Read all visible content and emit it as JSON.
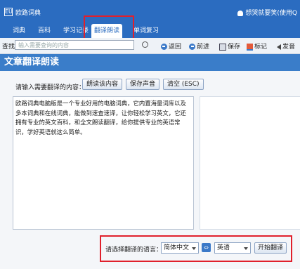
{
  "app": {
    "title": "欧路词典",
    "logo_text": "EU",
    "user": "想哭就要笑(使用Q"
  },
  "tabs": [
    {
      "label": "词典"
    },
    {
      "label": "百科"
    },
    {
      "label": "学习记录"
    },
    {
      "label": "翻译朗读",
      "active": true
    },
    {
      "label": "单词复习"
    }
  ],
  "toolbar": {
    "search_label": "查找",
    "search_placeholder": "输入需要查询的内容",
    "back": "返回",
    "forward": "前进",
    "save": "保存",
    "mark": "标记",
    "speak": "发音"
  },
  "header": {
    "title": "文章翻译朗读"
  },
  "input_section": {
    "label": "请输入需要翻译的内容：",
    "read_button": "朗读该内容",
    "save_audio_button": "保存声音",
    "clear_button": "清空 (ESC)",
    "text": "欧路词典电脑版是一个专业好用的电脑词典，它内置海量词库以及多本词典和在线词典，能做到速查速译，让你轻松学习英文，它还拥有专业的英文百科，和全文朗读翻译，给你提供专业的英语常识，学好英语就这么简单。"
  },
  "translate_section": {
    "lang_label": "请选择翻译的语言：",
    "source_lang": "简体中文",
    "target_lang": "英语",
    "swap_icon": "⇔",
    "start_button": "开始翻译"
  },
  "colors": {
    "titlebar": "#2b6cc0",
    "header": "#3a7dc9",
    "highlight": "#e0202c"
  }
}
